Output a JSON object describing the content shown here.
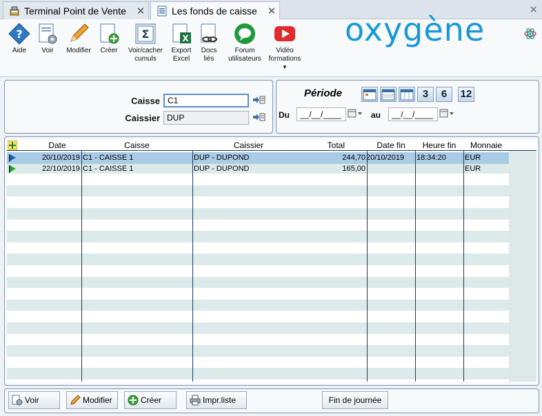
{
  "tabs": [
    {
      "label": "Terminal Point de Vente",
      "active": false
    },
    {
      "label": "Les fonds de caisse",
      "active": true
    }
  ],
  "toolbar": {
    "aide": "Aide",
    "voir": "Voir",
    "modifier": "Modifier",
    "creer": "Créer",
    "voircacher_1": "Voir/cacher",
    "voircacher_2": "cumuls",
    "export_1": "Export",
    "export_2": "Excel",
    "docs_1": "Docs",
    "docs_2": "liés",
    "forum_1": "Forum",
    "forum_2": "utilisateurs",
    "video_1": "Vidéo",
    "video_2": "formations"
  },
  "logo": "oxygène",
  "filters": {
    "caisse_label": "Caisse",
    "caisse_value": "C1",
    "caissier_label": "Caissier",
    "caissier_value": "DUP"
  },
  "periode": {
    "title": "Période",
    "du_label": "Du",
    "au_label": "au",
    "du_value": "__/__/____",
    "au_value": "__/__/____",
    "quick": [
      "3",
      "6",
      "12"
    ]
  },
  "table": {
    "headers": [
      "Date",
      "Caisse",
      "Caissier",
      "Total",
      "Date fin",
      "Heure fin",
      "Monnaie"
    ],
    "rows": [
      {
        "date": "20/10/2019",
        "caisse": "C1 - CAISSE 1",
        "caissier": "DUP - DUPOND",
        "total": "244,70",
        "date_fin": "20/10/2019",
        "heure_fin": "18:34:20",
        "monnaie": "EUR",
        "selected": true
      },
      {
        "date": "22/10/2019",
        "caisse": "C1 - CAISSE 1",
        "caissier": "DUP - DUPOND",
        "total": "165,00",
        "date_fin": "",
        "heure_fin": "",
        "monnaie": "EUR",
        "selected": false
      }
    ]
  },
  "bottom": {
    "voir": "Voir",
    "modifier": "Modifier",
    "creer": "Créer",
    "impr": "Impr.liste",
    "fin": "Fin de journée"
  },
  "colors": {
    "accent": "#1899d6",
    "selected_row": "#a9cbe6",
    "stripe": "#dcebea"
  }
}
